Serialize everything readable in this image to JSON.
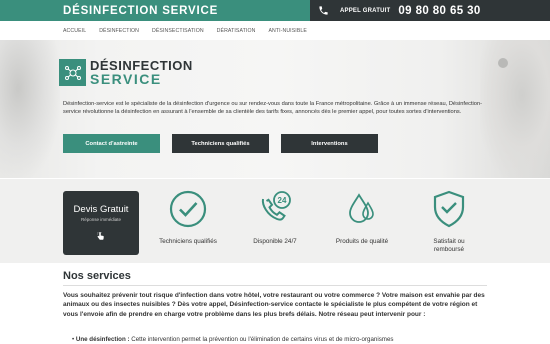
{
  "topbar": {
    "brand": "DÉSINFECTION SERVICE",
    "call_label": "APPEL GRATUIT",
    "phone_number": "09 80 80 65 30",
    "icon": "phone-icon"
  },
  "nav": {
    "items": [
      {
        "label": "ACCUEIL"
      },
      {
        "label": "DÉSINFECTION"
      },
      {
        "label": "DÉSINSECTISATION"
      },
      {
        "label": "DÉRATISATION"
      },
      {
        "label": "ANTI-NUISIBLE"
      }
    ]
  },
  "hero": {
    "logo_title": "DÉSINFECTION",
    "logo_subtitle": "SERVICE",
    "description": "Désinfection-service est le spécialiste de la désinfection d'urgence ou sur rendez-vous dans toute la France métropolitaine. Grâce à un immense réseau, Désinfection-service révolutionne la désinfection en assurant à l'ensemble de sa clientèle des tarifs fixes, annoncés dès le premier appel, pour toutes sortes d'interventions.",
    "buttons": [
      {
        "label": "Contact d'astreinte"
      },
      {
        "label": "Techniciens qualifiés"
      },
      {
        "label": "Interventions"
      }
    ]
  },
  "devis": {
    "title": "Devis Gratuit",
    "subtitle": "Réponse immédiate",
    "icon": "hand-pointer-icon"
  },
  "features": [
    {
      "label": "Techniciens qualifiés",
      "icon": "check-circle-icon"
    },
    {
      "label": "Disponible 24/7",
      "icon": "phone-24-icon",
      "icon_text": "24"
    },
    {
      "label": "Produits de qualité",
      "icon": "drops-icon"
    },
    {
      "label": "Satisfait ou remboursé",
      "icon": "shield-check-icon"
    }
  ],
  "services": {
    "title": "Nos services",
    "intro": "Vous souhaitez prévenir tout risque d'infection dans votre hôtel, votre restaurant ou votre commerce ? Votre maison est envahie par des animaux ou des insectes nuisibles ? Dès votre appel, Désinfection-service contacte le spécialiste le plus compétent de votre région et vous l'envoie afin de prendre en charge votre problème dans les plus brefs délais. Notre réseau peut intervenir pour :",
    "bullet_term": "Une désinfection :",
    "bullet_text": "Cette intervention permet la prévention ou l'élimination de certains virus et de micro-organismes"
  },
  "colors": {
    "accent": "#3a8f7d",
    "dark": "#2f3537"
  }
}
